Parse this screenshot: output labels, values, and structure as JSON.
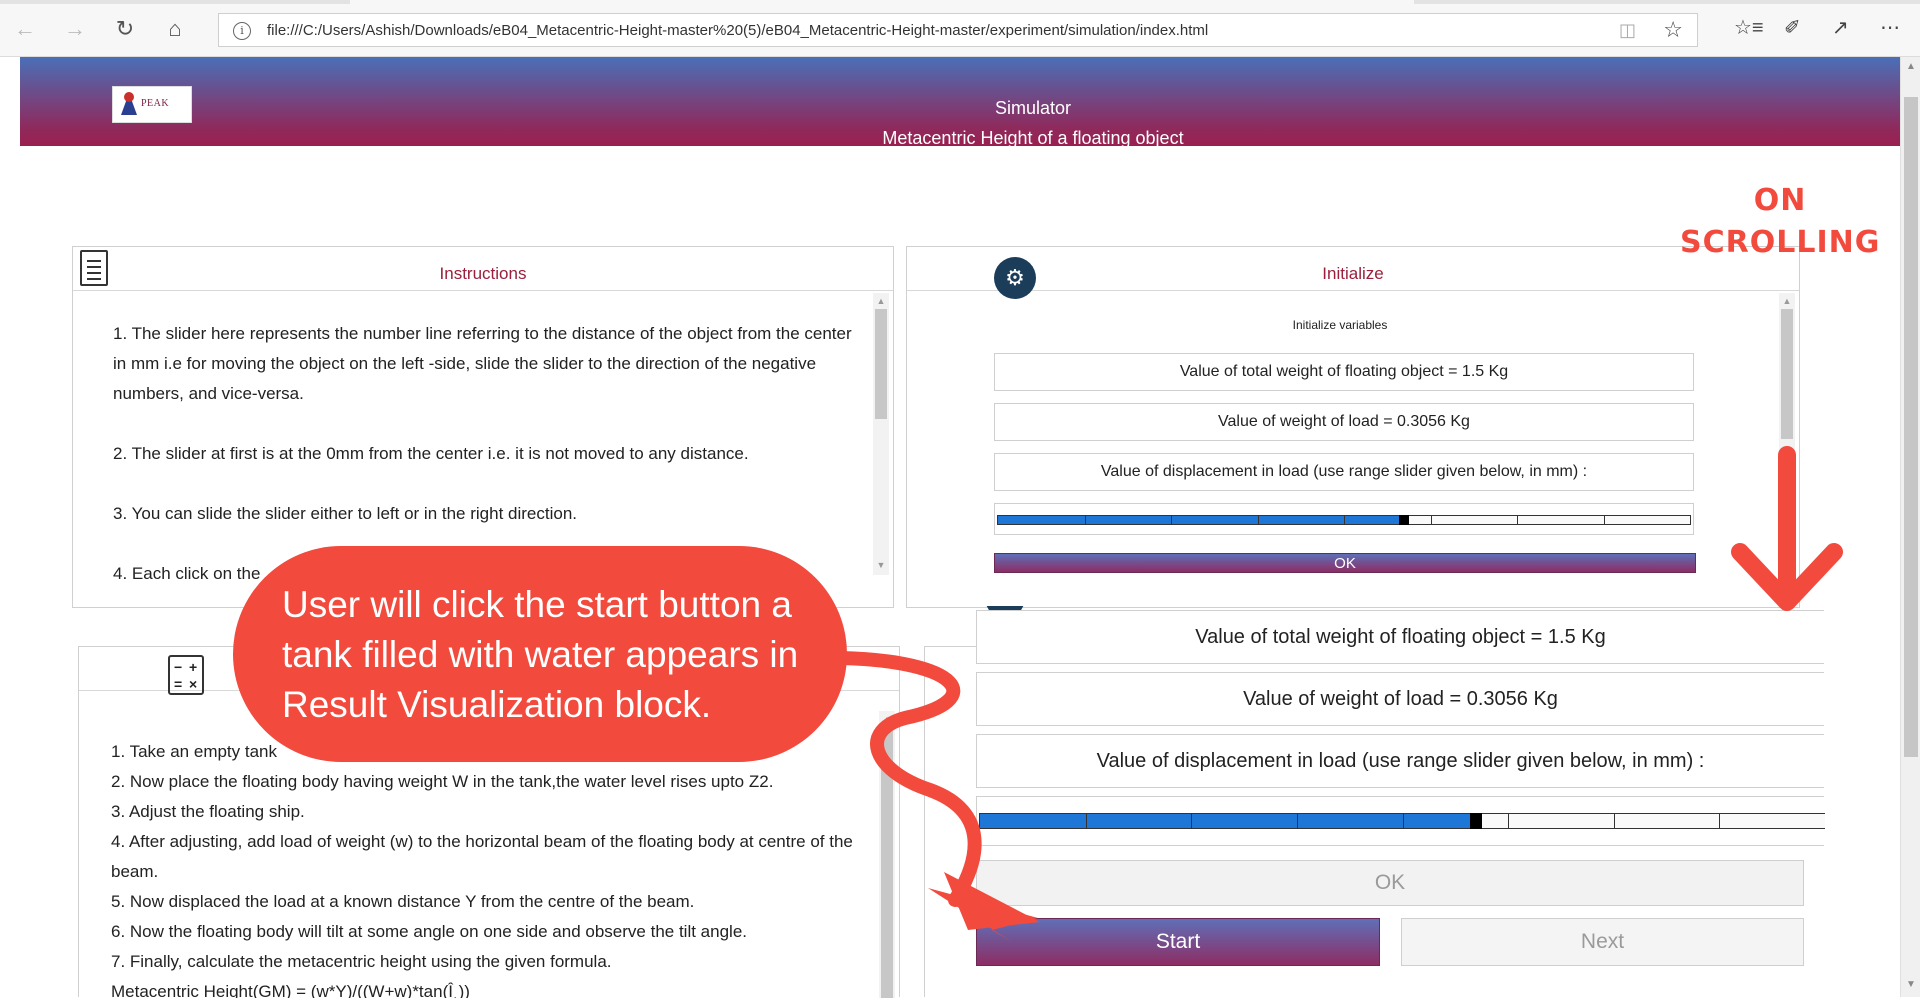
{
  "browser": {
    "url": "file:///C:/Users/Ashish/Downloads/eB04_Metacentric-Height-master%20(5)/eB04_Metacentric-Height-master/experiment/simulation/index.html"
  },
  "header": {
    "logo_text": "PEAK",
    "title_line1": "Simulator",
    "title_line2": "Metacentric Height of a floating object"
  },
  "instructions": {
    "title": "Instructions",
    "paragraphs": [
      "1. The slider here represents the number line referring to the distance of the object from the center in mm i.e for moving the object on the left -side, slide the slider to the direction of the negative numbers, and vice-versa.",
      "2. The slider at first is at the 0mm from the center i.e. it is not moved to any distance.",
      "3. You can slide the slider either to left or in the right direction.",
      "4. Each click on the"
    ]
  },
  "initialize": {
    "title": "Initialize",
    "subtitle": "Initialize variables",
    "total_weight": "Value of total weight of floating object = 1.5 Kg",
    "load_weight": "Value of weight of load = 0.3056 Kg",
    "displacement": "Value of displacement in load (use range slider given below, in mm) :",
    "ok_label": "OK"
  },
  "procedure": {
    "steps": [
      "1. Take an empty tank",
      "2. Now place the floating body having weight W in the tank,the water level rises upto Z2.",
      "3. Adjust the floating ship.",
      "4. After adjusting, add load of weight (w) to the horizontal beam of the floating body at centre of the beam.",
      "5. Now displaced the load at a known distance Y from the centre of the beam.",
      "6. Now the floating body will tilt at some angle on one side and observe the tilt angle.",
      "7. Finally, calculate the metacentric height using the given formula.",
      "Metacentric Height(GM) = (w*Y)/((W+w)*tan(Î¸))"
    ]
  },
  "scrolled_panel": {
    "total_weight": "Value of total weight of floating object = 1.5 Kg",
    "load_weight": "Value of weight of load = 0.3056 Kg",
    "displacement": "Value of displacement in load (use range slider given below, in mm) :",
    "ok_label": "OK",
    "start_label": "Start",
    "next_label": "Next"
  },
  "slider": {
    "value_fraction": 0.58
  },
  "annotation": {
    "bubble_text": "User will click the start button a tank filled with water appears in Result Visualization block.",
    "on_scrolling": "ON SCROLLING"
  },
  "colors": {
    "accent": "#9a1f3c",
    "annotation": "#f24a3d",
    "slider_fill": "#1e77d6"
  },
  "icons": [
    "back-icon",
    "forward-icon",
    "refresh-icon",
    "home-icon",
    "info-icon",
    "reader-view-icon",
    "favorite-star-icon",
    "favorites-list-icon",
    "pen-icon",
    "share-icon",
    "more-icon",
    "document-icon",
    "gear-icon",
    "calculator-icon"
  ]
}
